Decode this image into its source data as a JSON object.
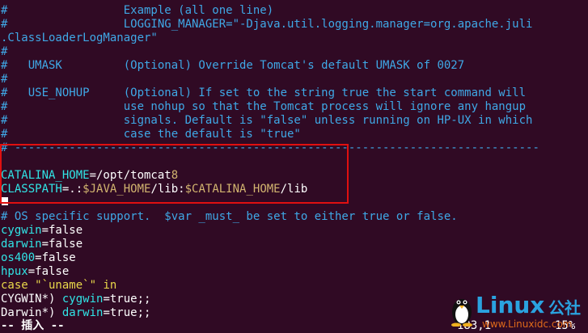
{
  "terminal": {
    "lines": [
      {
        "text": "#                 Example (all one line)"
      },
      {
        "text": "#                 LOGGING_MANAGER=\"-Djava.util.logging.manager=org.apache.juli"
      },
      {
        "text": ".ClassLoaderLogManager\""
      },
      {
        "text": "#"
      },
      {
        "text": "#   UMASK         (Optional) Override Tomcat's default UMASK of 0027"
      },
      {
        "text": "#"
      },
      {
        "text": "#   USE_NOHUP     (Optional) If set to the string true the start command will"
      },
      {
        "text": "#                 use nohup so that the Tomcat process will ignore any hangup"
      },
      {
        "text": "#                 signals. Default is \"false\" unless running on HP-UX in which"
      },
      {
        "text": "#                 case the default is \"true\""
      },
      {
        "text": "# -----------------------------------------------------------------------------"
      },
      {
        "text": ""
      },
      {
        "catalina_home_key": "CATALINA_HOME",
        "catalina_home_eq": "=/opt/tomcat",
        "catalina_home_ver": "8"
      },
      {
        "classpath_key": "CLASSPATH",
        "classpath_eq": "=.:",
        "classpath_java_home": "$JAVA_HOME",
        "classpath_lib1": "/lib:",
        "classpath_catalina_home": "$CATALINA_HOME",
        "classpath_lib2": "/lib"
      },
      {
        "text": ""
      },
      {
        "text": "# OS specific support.  $var _must_ be set to either true or false."
      },
      {
        "key": "cygwin",
        "eq": "=false"
      },
      {
        "key": "darwin",
        "eq": "=false"
      },
      {
        "key": "os400",
        "eq": "=false"
      },
      {
        "key": "hpux",
        "eq": "=false"
      },
      {
        "kw": "case",
        "str": " \"`uname`\"",
        "kw2": " in"
      },
      {
        "pattern": "CYGWIN*) ",
        "key": "cygwin",
        "eq": "=true;;"
      },
      {
        "pattern": "Darwin*) ",
        "key": "darwin",
        "eq": "=true;;"
      }
    ]
  },
  "status_bar": {
    "mode": "-- 插入 --",
    "position": "183,1",
    "percent": "15%"
  },
  "watermark": {
    "brand": "Linux",
    "brand_cn": "公社",
    "url": "www.Linuxidc.com"
  },
  "colors": {
    "background": "#300a24",
    "comment": "#3fa8e6",
    "variable": "#30e4e6",
    "string": "#e9d84a",
    "highlight_border": "#e01010"
  }
}
